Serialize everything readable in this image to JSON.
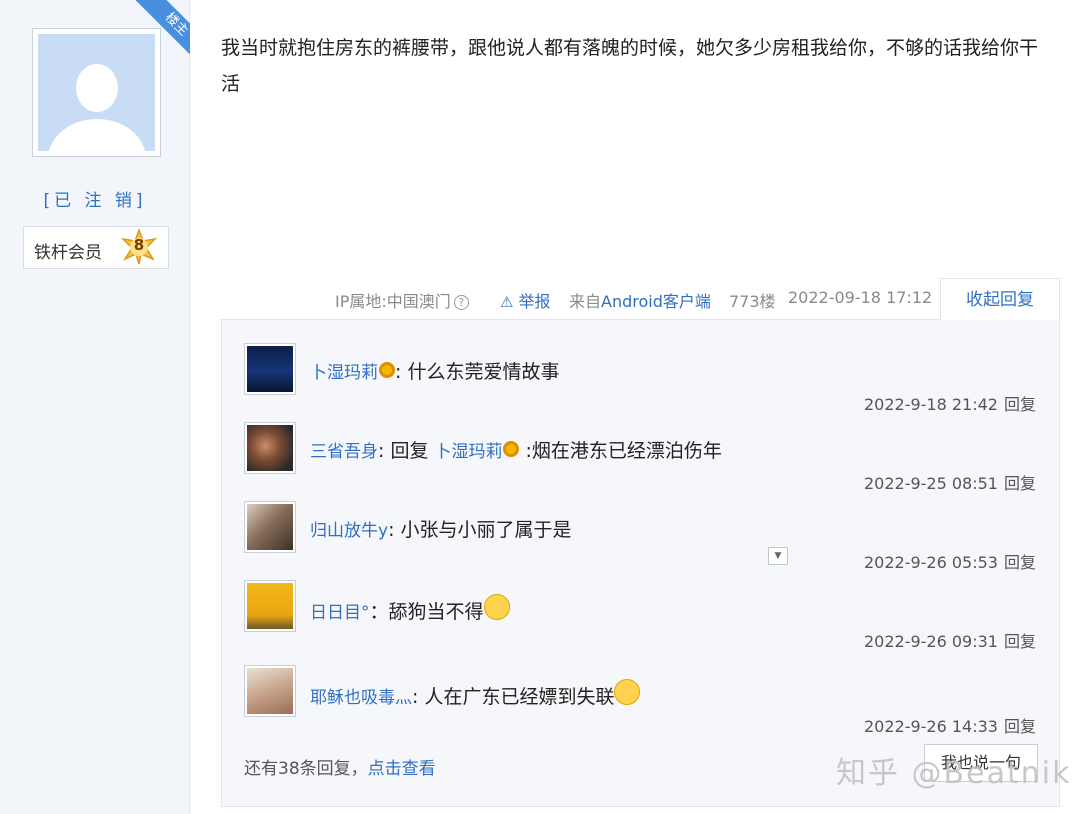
{
  "author": {
    "ribbon": "楼主",
    "status": "[已 注 销]",
    "member_label": "铁杆会员",
    "level": "8"
  },
  "post": {
    "text": "我当时就抱住房东的裤腰带，跟他说人都有落魄的时候，她欠多少房租我给你，不够的话我给你干活",
    "ip": "IP属地:中国澳门",
    "help_icon": "?",
    "report": "举报",
    "from_prefix": "来自",
    "from_app": "Android客户端",
    "floor": "773楼",
    "time": "2022-09-18 17:12",
    "collapse": "收起回复"
  },
  "replies": [
    {
      "user": "卜湿玛莉",
      "pre": "",
      "target": "",
      "content": ": 什么东莞爱情故事",
      "time": "2022-9-18 21:42",
      "reply_label": "回复"
    },
    {
      "user": "三省吾身",
      "pre": ": 回复 ",
      "target": "卜湿玛莉",
      "content": " :烟在港东已经漂泊伤年",
      "time": "2022-9-25 08:51",
      "reply_label": "回复"
    },
    {
      "user": "归山放牛y",
      "pre": "",
      "target": "",
      "content": ": 小张与小丽了属于是",
      "time": "2022-9-26 05:53",
      "reply_label": "回复"
    },
    {
      "user": "日日目°",
      "pre": "",
      "target": "",
      "content": "：舔狗当不得",
      "time": "2022-9-26 09:31",
      "reply_label": "回复"
    },
    {
      "user": "耶稣也吸毒灬",
      "pre": "",
      "target": "",
      "content": ": 人在广东已经嫖到失联",
      "time": "2022-9-26 14:33",
      "reply_label": "回复"
    }
  ],
  "more": {
    "prefix": "还有38条回复，",
    "link": "点击查看"
  },
  "say_button": "我也说一句",
  "watermark": "知乎 @Beatnik",
  "colors": {
    "link_blue": "#2f6fc4",
    "sidebar_bg": "#f2f5fa",
    "reply_bg": "#f5f7fa"
  }
}
